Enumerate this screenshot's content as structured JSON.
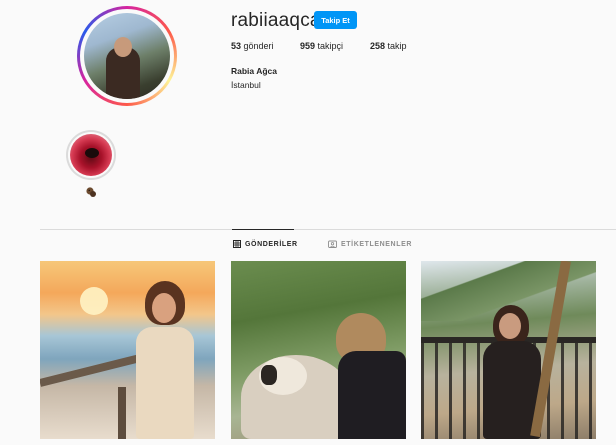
{
  "profile": {
    "username": "rabiiaaqca",
    "follow_button": "Takip Et",
    "full_name": "Rabia Ağca",
    "location": "İstanbul",
    "stats": {
      "posts_count": "53",
      "posts_label": "gönderi",
      "followers_count": "959",
      "followers_label": "takipçi",
      "following_count": "258",
      "following_label": "takip"
    }
  },
  "highlights": [
    {
      "label_icon": "sloth-emoji-icon"
    }
  ],
  "tabs": [
    {
      "label": "GÖNDERİLER",
      "icon": "grid-icon",
      "active": true
    },
    {
      "label": "ETİKETLENENLER",
      "icon": "tag-icon",
      "active": false
    }
  ],
  "posts": [
    {
      "alt": "sunset-beach-photo"
    },
    {
      "alt": "dog-hug-photo"
    },
    {
      "alt": "balcony-mountain-photo"
    }
  ],
  "colors": {
    "accent": "#0095f6",
    "text": "#262626",
    "muted": "#8e8e8e",
    "background": "#fafafa",
    "divider": "#dbdbdb"
  }
}
